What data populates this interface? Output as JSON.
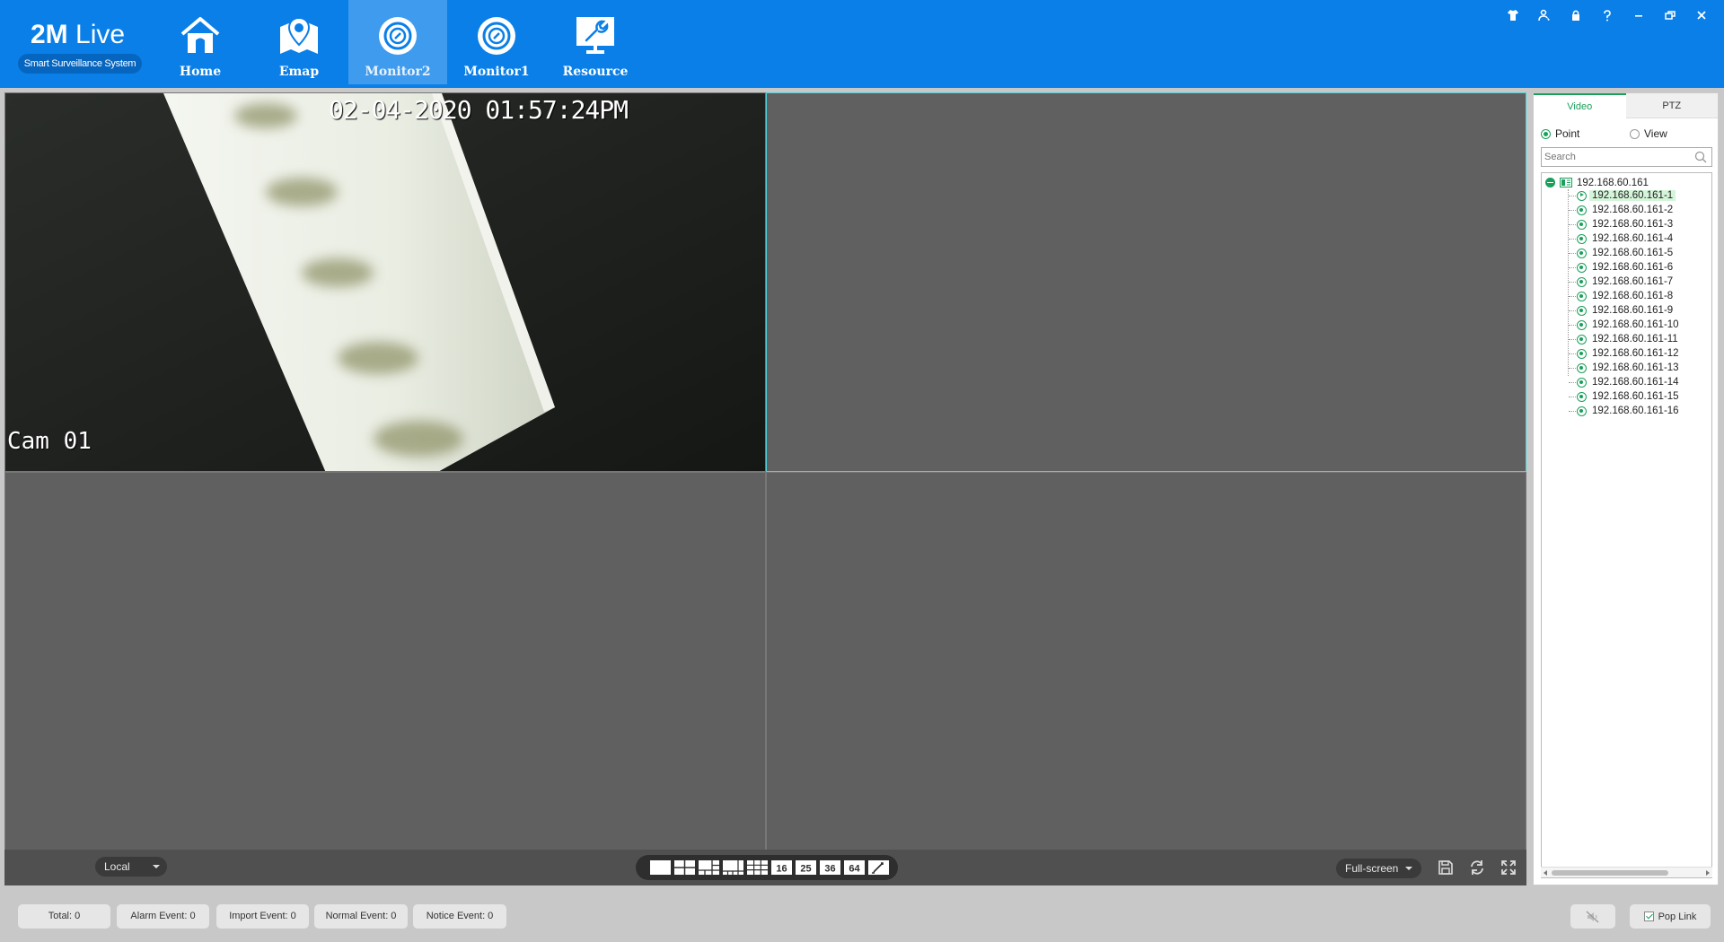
{
  "app": {
    "title_bold": "2M",
    "title_rest": " Live",
    "subtitle": "Smart Surveillance System"
  },
  "nav": [
    {
      "label": "Home",
      "icon": "home-icon",
      "active": false
    },
    {
      "label": "Emap",
      "icon": "map-pin-icon",
      "active": false
    },
    {
      "label": "Monitor2",
      "icon": "camera-monitor-icon",
      "active": true
    },
    {
      "label": "Monitor1",
      "icon": "camera-monitor-icon",
      "active": false
    },
    {
      "label": "Resource",
      "icon": "wrench-monitor-icon",
      "active": false
    }
  ],
  "window_controls": [
    "shirt-icon",
    "user-switch-icon",
    "lock-icon",
    "help-icon",
    "minimize-icon",
    "restore-icon",
    "close-icon"
  ],
  "video": {
    "osd_time": "02-04-2020 01:57:24PM",
    "osd_camera": "Cam 01"
  },
  "toolbar": {
    "local_select": "Local",
    "layouts": [
      "1",
      "4",
      "6",
      "8",
      "9",
      "16",
      "25",
      "36",
      "64",
      "custom"
    ],
    "fullscreen_select": "Full-screen"
  },
  "right_panel": {
    "tabs": [
      "Video",
      "PTZ"
    ],
    "active_tab": "Video",
    "radio_point": "Point",
    "radio_view": "View",
    "search_placeholder": "Search",
    "root": "192.168.60.161",
    "channels": [
      "192.168.60.161-1",
      "192.168.60.161-2",
      "192.168.60.161-3",
      "192.168.60.161-4",
      "192.168.60.161-5",
      "192.168.60.161-6",
      "192.168.60.161-7",
      "192.168.60.161-8",
      "192.168.60.161-9",
      "192.168.60.161-10",
      "192.168.60.161-11",
      "192.168.60.161-12",
      "192.168.60.161-13",
      "192.168.60.161-14",
      "192.168.60.161-15",
      "192.168.60.161-16"
    ],
    "selected_channel": "192.168.60.161-1"
  },
  "status": {
    "total": "Total: 0",
    "alarm": "Alarm Event: 0",
    "import": "Import Event: 0",
    "normal": "Normal Event: 0",
    "notice": "Notice Event: 0",
    "pop_link": "Pop Link"
  },
  "colors": {
    "topbar": "#0a7fe8",
    "accent_green": "#1aa05a",
    "selected_cell_border": "#4fd1d9"
  }
}
